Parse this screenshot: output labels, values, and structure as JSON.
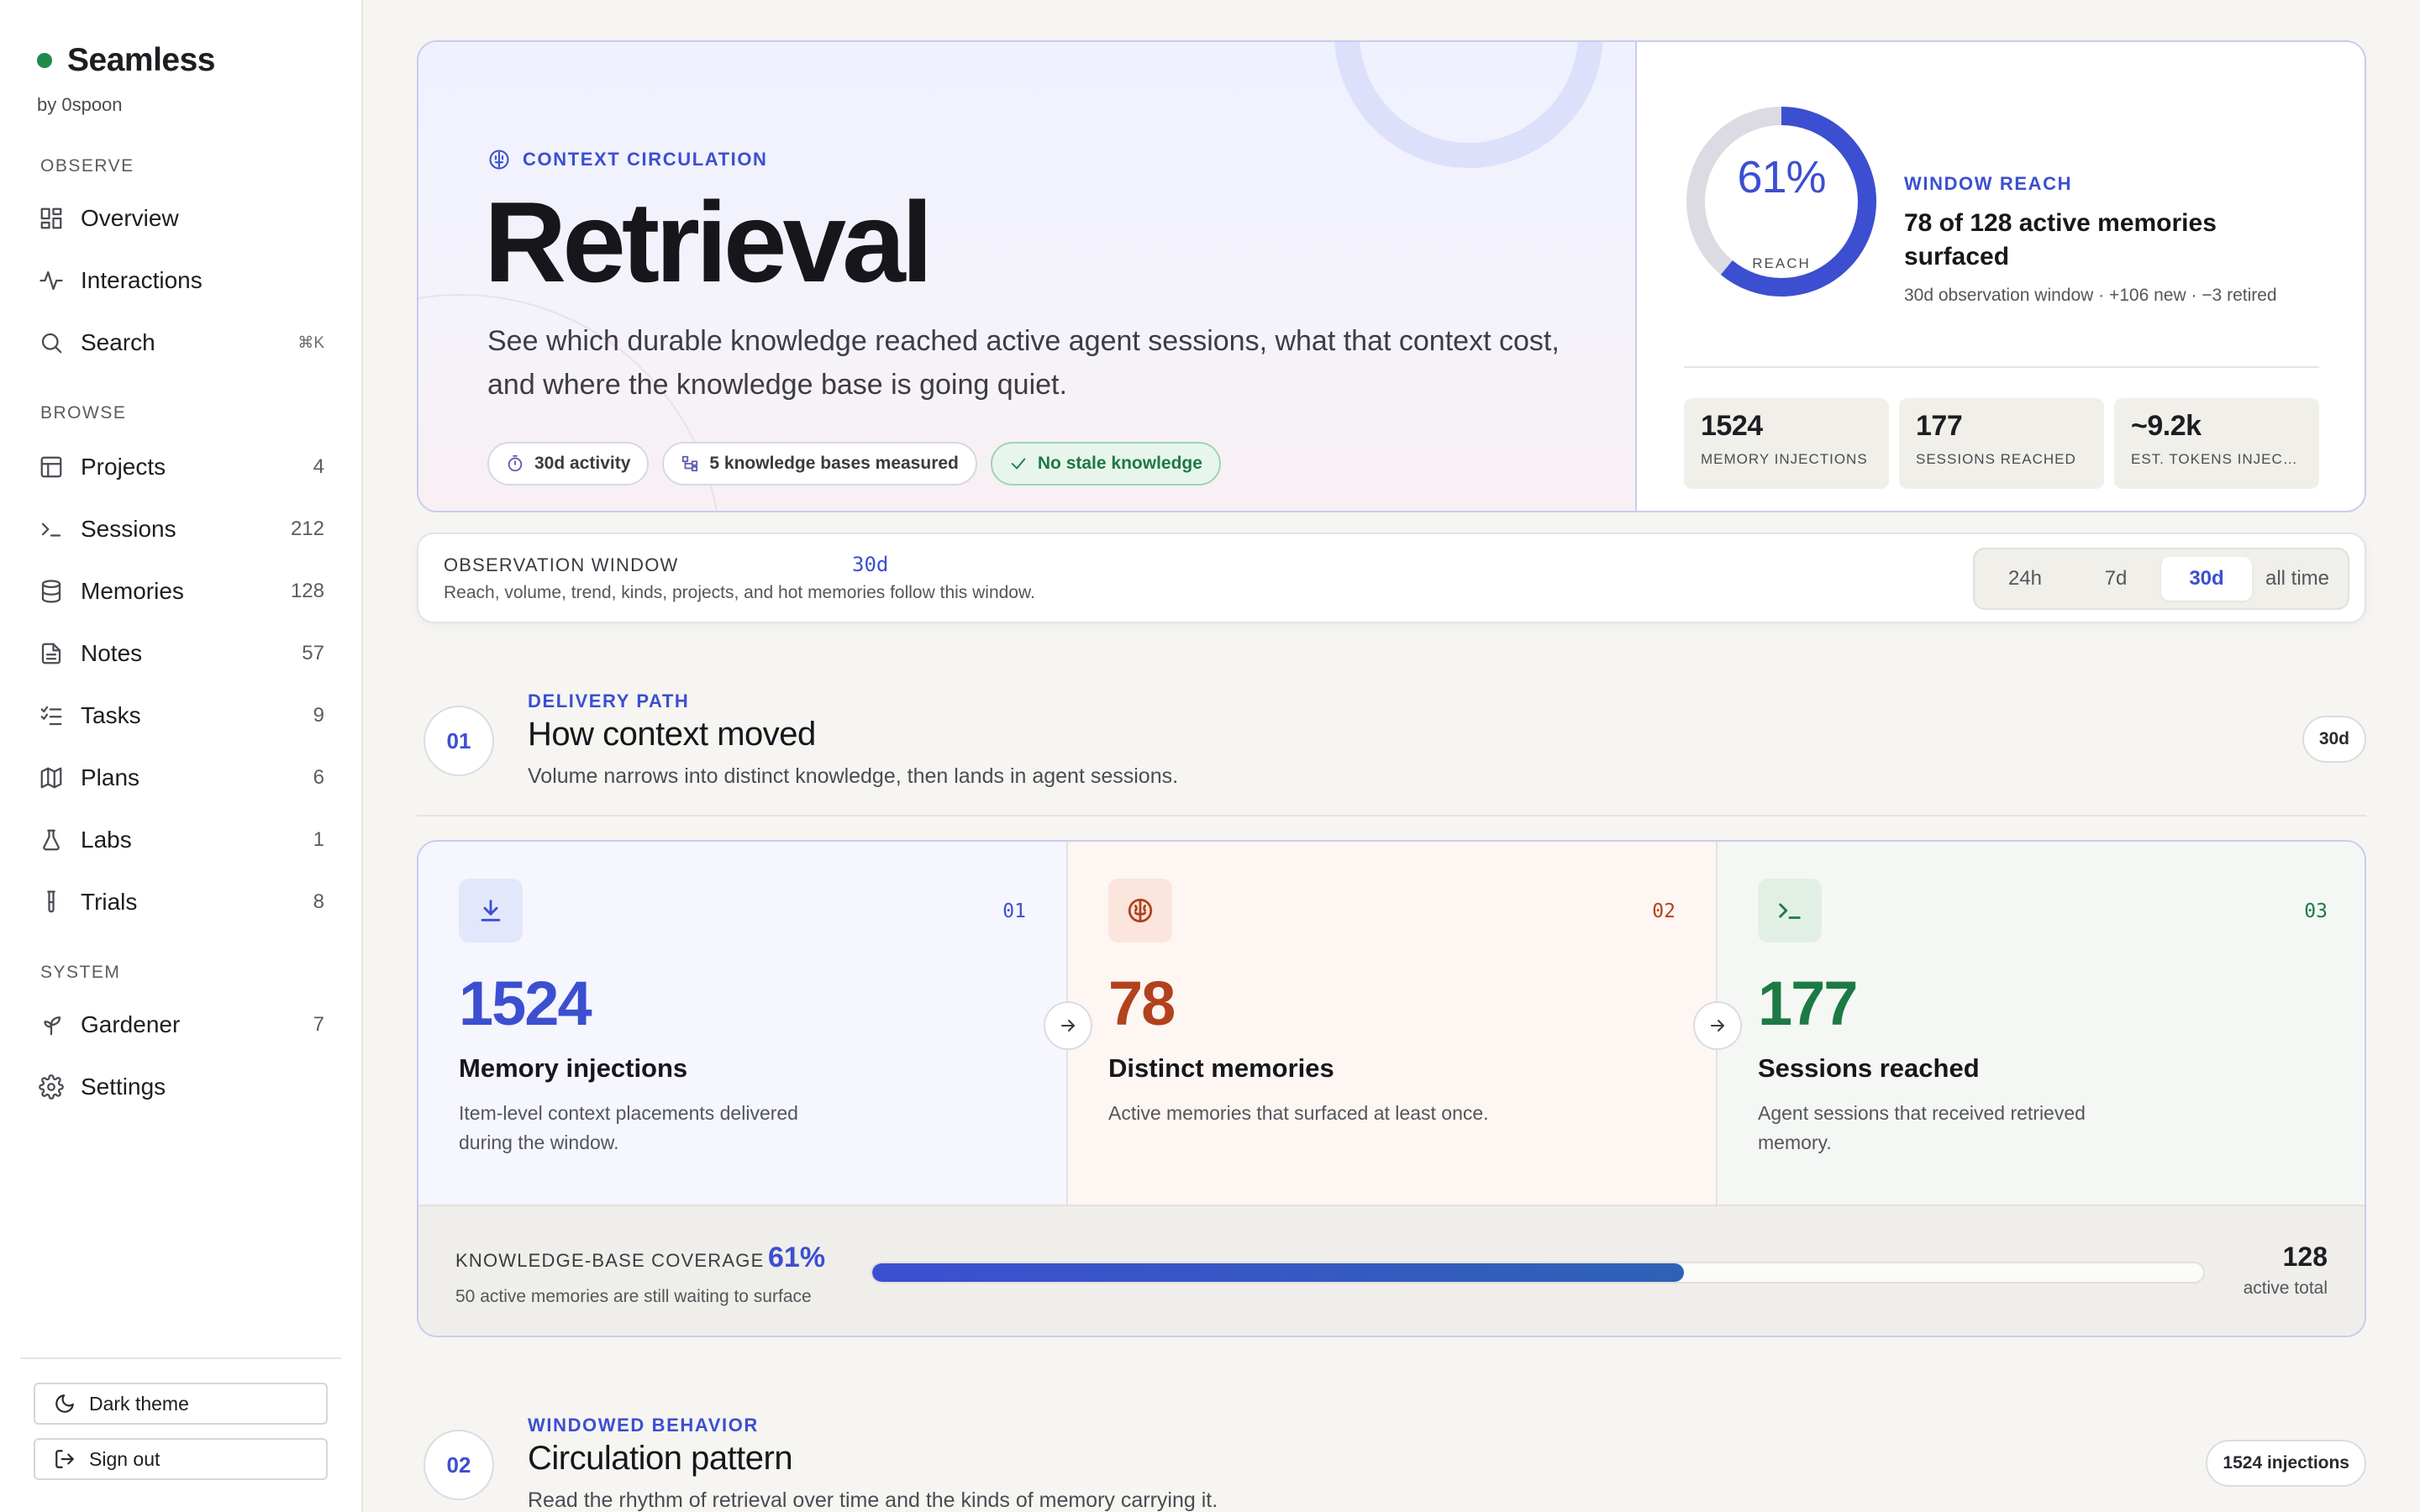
{
  "sidebar": {
    "brand": "Seamless",
    "brand_by": "by 0spoon",
    "sections": {
      "observe": "OBSERVE",
      "browse": "BROWSE",
      "system": "SYSTEM"
    },
    "items": {
      "overview": {
        "label": "Overview",
        "icon": "grid-icon"
      },
      "interactions": {
        "label": "Interactions",
        "icon": "activity-icon"
      },
      "search": {
        "label": "Search",
        "icon": "search-icon",
        "shortcut": "⌘K"
      },
      "projects": {
        "label": "Projects",
        "icon": "table-icon",
        "count": "4"
      },
      "sessions": {
        "label": "Sessions",
        "icon": "terminal-icon",
        "count": "212"
      },
      "memories": {
        "label": "Memories",
        "icon": "database-icon",
        "count": "128"
      },
      "notes": {
        "label": "Notes",
        "icon": "note-icon",
        "count": "57"
      },
      "tasks": {
        "label": "Tasks",
        "icon": "checklist-icon",
        "count": "9"
      },
      "plans": {
        "label": "Plans",
        "icon": "map-icon",
        "count": "6"
      },
      "labs": {
        "label": "Labs",
        "icon": "flask-icon",
        "count": "1"
      },
      "trials": {
        "label": "Trials",
        "icon": "test-tube-icon",
        "count": "8"
      },
      "gardener": {
        "label": "Gardener",
        "icon": "sprout-icon",
        "count": "7"
      },
      "settings": {
        "label": "Settings",
        "icon": "gear-icon"
      }
    },
    "dark_theme": "Dark theme",
    "sign_out": "Sign out"
  },
  "hero": {
    "eyebrow": "CONTEXT CIRCULATION",
    "title": "Retrieval",
    "description": "See which durable knowledge reached active agent sessions, what that context cost, and where the knowledge base is going quiet.",
    "chips": {
      "activity": "30d activity",
      "bases": "5 knowledge bases measured",
      "stale": "No stale knowledge"
    },
    "reach": {
      "percent_label": "61%",
      "percent_value": 0.61,
      "gauge_caption": "REACH",
      "eyebrow": "WINDOW REACH",
      "title": "78 of 128 active memories surfaced",
      "subtitle": "30d observation window · +106 new · −3 retired"
    },
    "stats": {
      "injections": {
        "value": "1524",
        "label": "MEMORY INJECTIONS"
      },
      "sessions": {
        "value": "177",
        "label": "SESSIONS REACHED"
      },
      "tokens": {
        "value": "~9.2k",
        "label": "EST. TOKENS INJECTED"
      }
    }
  },
  "observation": {
    "label": "OBSERVATION WINDOW",
    "value": "30d",
    "subtitle": "Reach, volume, trend, kinds, projects, and hot memories follow this window.",
    "options": {
      "h24": "24h",
      "d7": "7d",
      "d30": "30d",
      "all": "all time"
    },
    "selected": "30d"
  },
  "section1": {
    "number": "01",
    "eyebrow": "DELIVERY PATH",
    "title": "How context moved",
    "subtitle": "Volume narrows into distinct knowledge, then lands in agent sessions.",
    "pill": "30d"
  },
  "flow": {
    "stage1": {
      "num": "01",
      "value": "1524",
      "title": "Memory injections",
      "desc": "Item-level context placements delivered during the window."
    },
    "stage2": {
      "num": "02",
      "value": "78",
      "title": "Distinct memories",
      "desc": "Active memories that surfaced at least once."
    },
    "stage3": {
      "num": "03",
      "value": "177",
      "title": "Sessions reached",
      "desc": "Agent sessions that received retrieved memory."
    }
  },
  "coverage": {
    "label": "KNOWLEDGE-BASE COVERAGE",
    "percent_label": "61%",
    "fraction": 0.61,
    "subtitle": "50 active memories are still waiting to surface",
    "total": "128",
    "total_label": "active total"
  },
  "section2": {
    "number": "02",
    "eyebrow": "WINDOWED BEHAVIOR",
    "title": "Circulation pattern",
    "subtitle": "Read the rhythm of retrieval over time and the kinds of memory carrying it.",
    "pill": "1524 injections"
  },
  "colors": {
    "accent": "#3c4fd0",
    "brand_dot": "#1f8a4c",
    "stage2": "#b2421e",
    "stage3": "#1c7a44"
  }
}
